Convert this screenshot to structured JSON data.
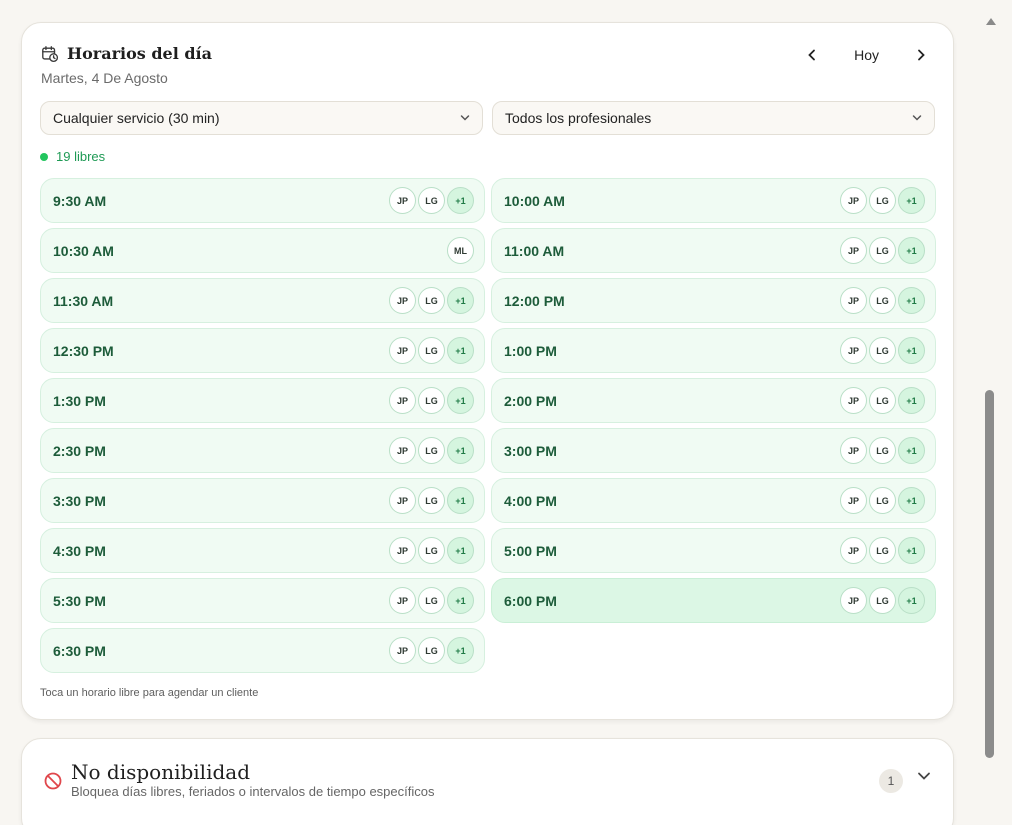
{
  "schedule": {
    "title": "Horarios del día",
    "date": "Martes, 4 De Agosto",
    "today_label": "Hoy",
    "service_select": "Cualquier servicio (30 min)",
    "professional_select": "Todos los profesionales",
    "free_count": "19 libres",
    "hint": "Toca un horario libre para agendar un cliente",
    "slots": [
      {
        "time": "9:30 AM",
        "avatars": [
          "JP",
          "LG",
          "+1"
        ]
      },
      {
        "time": "10:00 AM",
        "avatars": [
          "JP",
          "LG",
          "+1"
        ]
      },
      {
        "time": "10:30 AM",
        "avatars": [
          "ML"
        ]
      },
      {
        "time": "11:00 AM",
        "avatars": [
          "JP",
          "LG",
          "+1"
        ]
      },
      {
        "time": "11:30 AM",
        "avatars": [
          "JP",
          "LG",
          "+1"
        ]
      },
      {
        "time": "12:00 PM",
        "avatars": [
          "JP",
          "LG",
          "+1"
        ]
      },
      {
        "time": "12:30 PM",
        "avatars": [
          "JP",
          "LG",
          "+1"
        ]
      },
      {
        "time": "1:00 PM",
        "avatars": [
          "JP",
          "LG",
          "+1"
        ]
      },
      {
        "time": "1:30 PM",
        "avatars": [
          "JP",
          "LG",
          "+1"
        ]
      },
      {
        "time": "2:00 PM",
        "avatars": [
          "JP",
          "LG",
          "+1"
        ]
      },
      {
        "time": "2:30 PM",
        "avatars": [
          "JP",
          "LG",
          "+1"
        ]
      },
      {
        "time": "3:00 PM",
        "avatars": [
          "JP",
          "LG",
          "+1"
        ]
      },
      {
        "time": "3:30 PM",
        "avatars": [
          "JP",
          "LG",
          "+1"
        ]
      },
      {
        "time": "4:00 PM",
        "avatars": [
          "JP",
          "LG",
          "+1"
        ]
      },
      {
        "time": "4:30 PM",
        "avatars": [
          "JP",
          "LG",
          "+1"
        ]
      },
      {
        "time": "5:00 PM",
        "avatars": [
          "JP",
          "LG",
          "+1"
        ]
      },
      {
        "time": "5:30 PM",
        "avatars": [
          "JP",
          "LG",
          "+1"
        ]
      },
      {
        "time": "6:00 PM",
        "avatars": [
          "JP",
          "LG",
          "+1"
        ],
        "highlighted": true
      },
      {
        "time": "6:30 PM",
        "avatars": [
          "JP",
          "LG",
          "+1"
        ]
      }
    ]
  },
  "unavailability": {
    "title": "No disponibilidad",
    "subtitle": "Bloquea días libres, feriados o intervalos de tiempo específicos",
    "count": "1"
  },
  "colors": {
    "free_dot": "#22c55e",
    "slot_bg": "#f0fbf3",
    "slot_text": "#1d5c3a",
    "block_icon": "#e0474c"
  }
}
